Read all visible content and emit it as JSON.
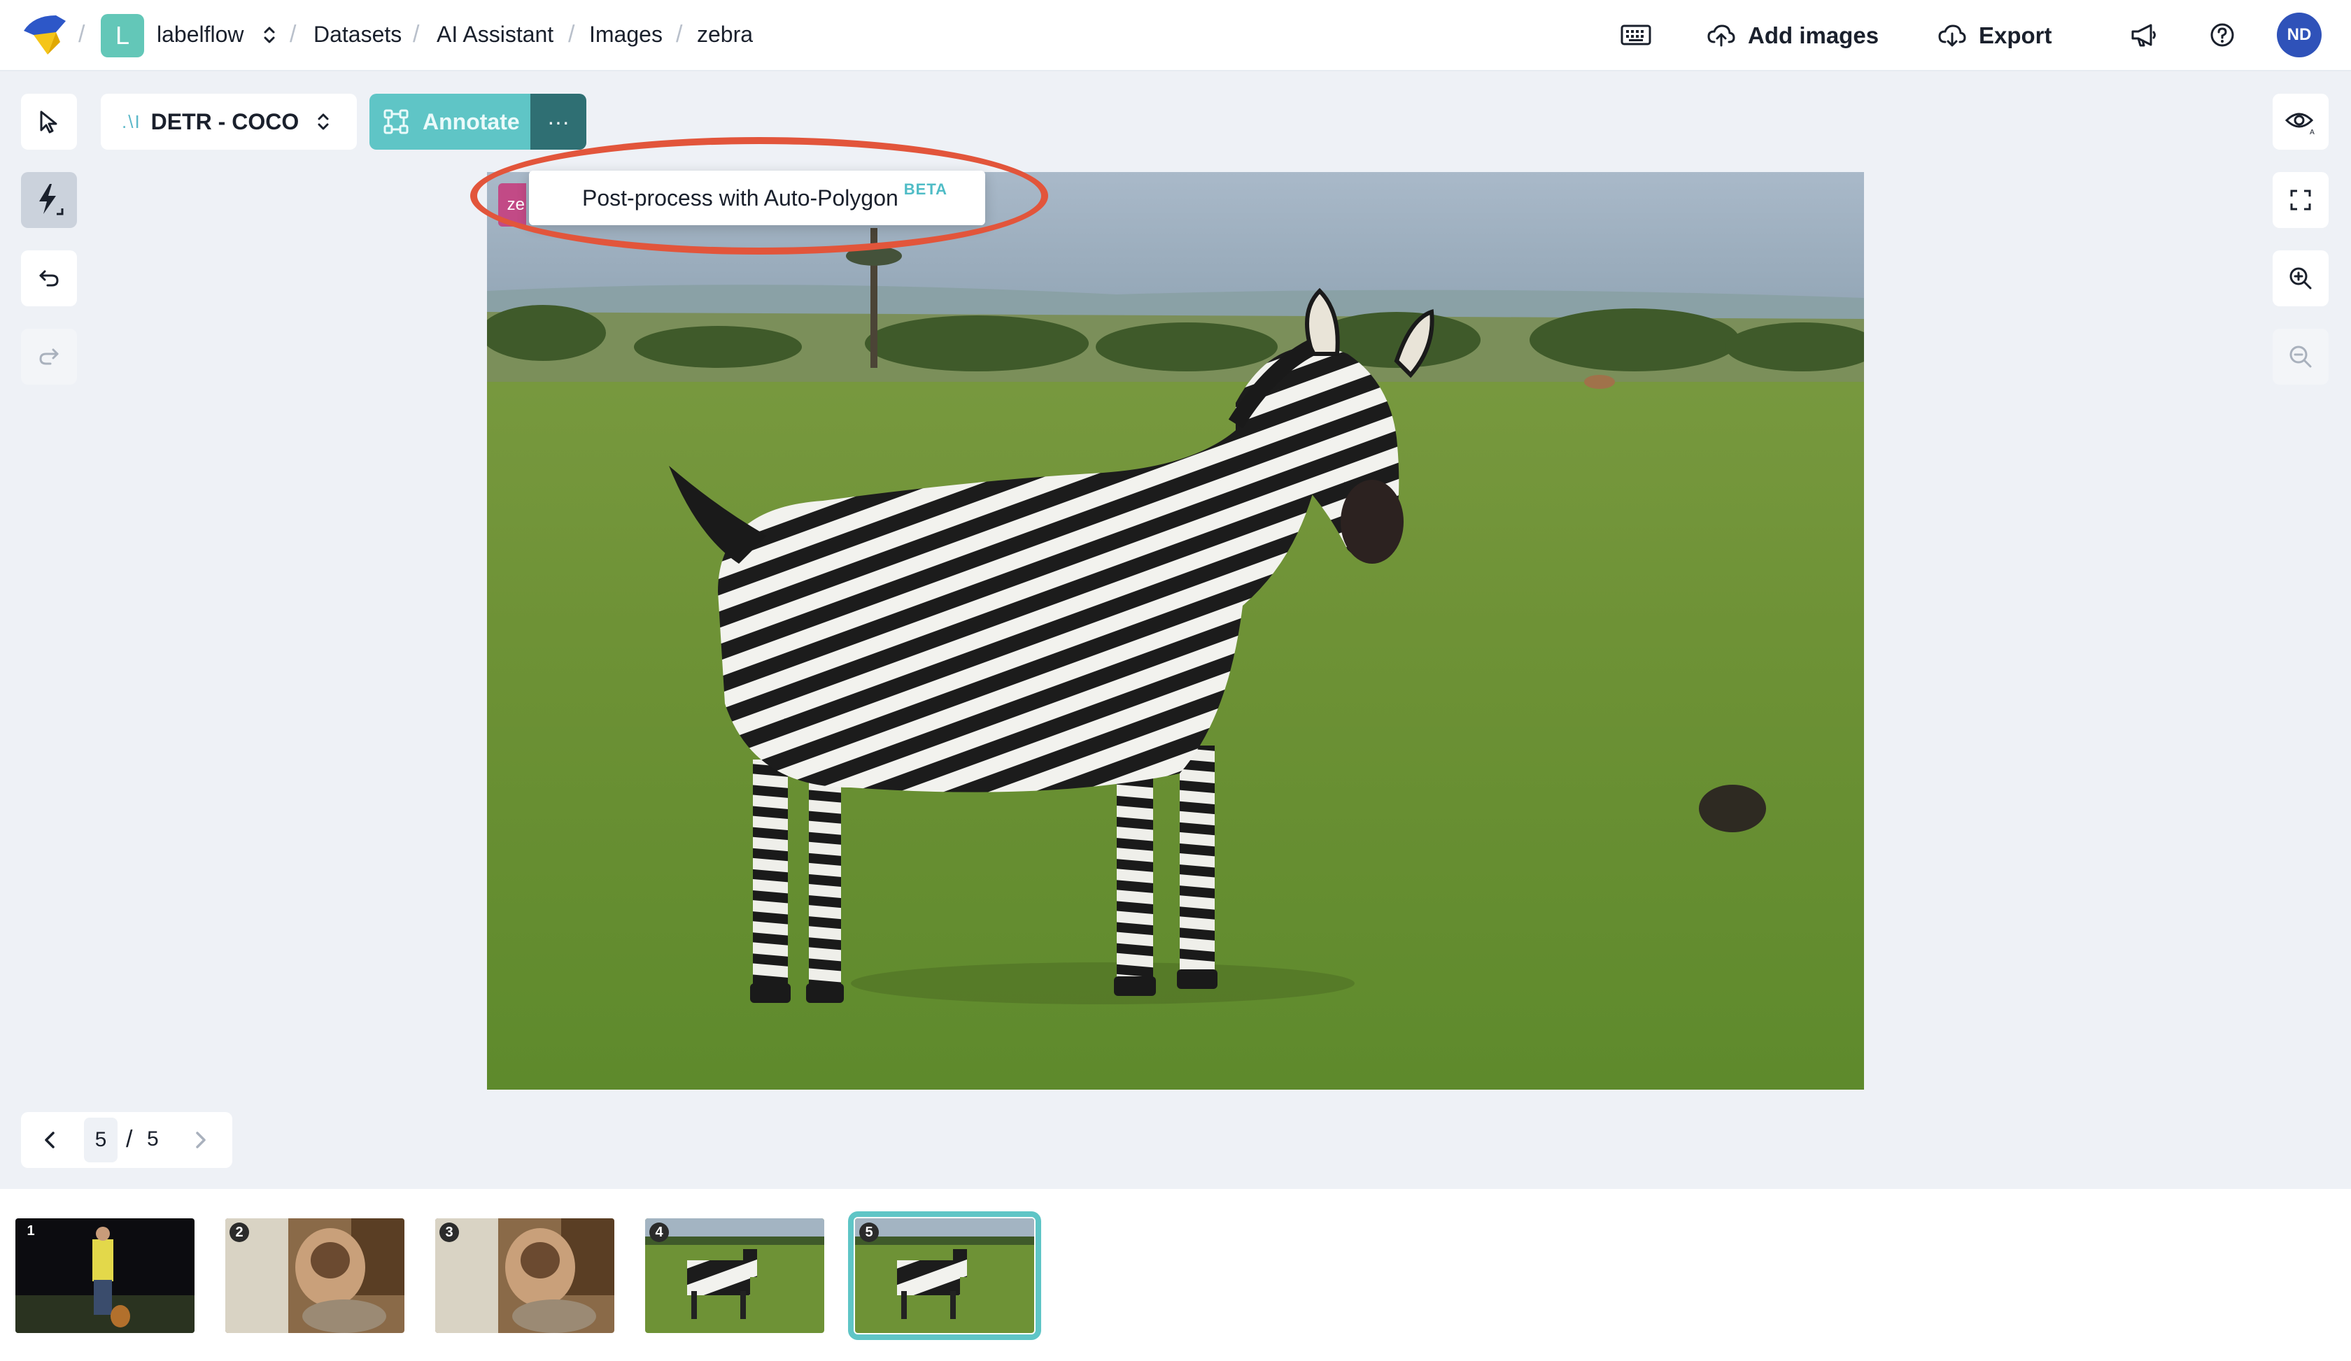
{
  "breadcrumb": {
    "workspace_initial": "L",
    "workspace": "labelflow",
    "items": [
      "Datasets",
      "AI Assistant",
      "Images",
      "zebra"
    ]
  },
  "header": {
    "add_images": "Add images",
    "export": "Export",
    "avatar_initials": "ND"
  },
  "toolbar": {
    "model_mark": ".\\I",
    "model": "DETR - COCO",
    "annotate": "Annotate",
    "more": "···"
  },
  "menu": {
    "pink_label": "ze",
    "item": "Post-process with Auto-Polygon",
    "badge": "BETA"
  },
  "pager": {
    "current": "5",
    "separator": "/",
    "total": "5"
  },
  "thumbnails": [
    {
      "number": "1"
    },
    {
      "number": "2"
    },
    {
      "number": "3"
    },
    {
      "number": "4"
    },
    {
      "number": "5",
      "selected": true
    }
  ],
  "colors": {
    "accent": "#5fc5c6",
    "highlight_ring": "#e2553b",
    "avatar": "#2f52b9",
    "workspace_badge": "#63c7b8"
  },
  "icons": {
    "logo": "labelflow-logo",
    "keyboard": "keyboard-icon",
    "upload": "cloud-upload-icon",
    "download": "cloud-download-icon",
    "announce": "megaphone-icon",
    "help": "help-icon",
    "select": "cursor-icon",
    "ai": "lightning-icon",
    "undo": "undo-icon",
    "redo": "redo-icon",
    "view": "eye-icon",
    "fullscreen": "fullscreen-icon",
    "zoom_in": "zoom-in-icon",
    "zoom_out": "zoom-out-icon"
  }
}
